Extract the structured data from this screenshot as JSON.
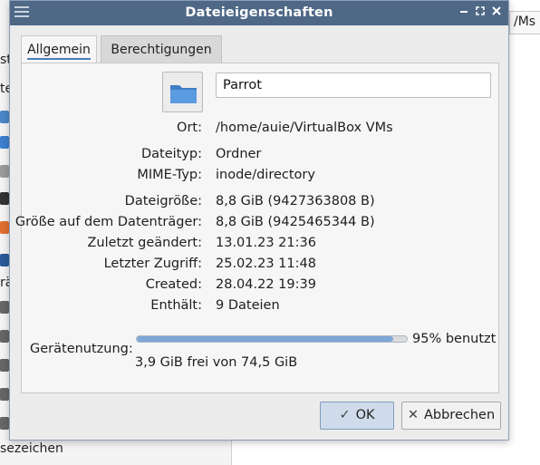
{
  "background": {
    "sidebar_fragments": [
      "st",
      "te",
      "rä"
    ],
    "bottom_fragment": "sezeichen",
    "topright_fragment": "/Ms"
  },
  "dialog": {
    "title": "Dateieigenschaften",
    "tabs": [
      {
        "label": "Allgemein",
        "active": true
      },
      {
        "label": "Berechtigungen",
        "active": false
      }
    ],
    "name_value": "Parrot",
    "properties": {
      "location": {
        "label": "Ort:",
        "value": "/home/auie/VirtualBox VMs"
      },
      "file_type": {
        "label": "Dateityp:",
        "value": "Ordner"
      },
      "mime_type": {
        "label": "MIME-Typ:",
        "value": "inode/directory"
      },
      "file_size": {
        "label": "Dateigröße:",
        "value": "8,8 GiB (9427363808 B)"
      },
      "disk_size": {
        "label": "Größe auf dem Datenträger:",
        "value": "8,8 GiB (9425465344 B)"
      },
      "modified": {
        "label": "Zuletzt geändert:",
        "value": "13.01.23 21:36"
      },
      "accessed": {
        "label": "Letzter Zugriff:",
        "value": "25.02.23 11:48"
      },
      "created": {
        "label": "Created:",
        "value": "28.04.22 19:39"
      },
      "contains": {
        "label": "Enthält:",
        "value": "9 Dateien"
      }
    },
    "device_usage": {
      "label": "Gerätenutzung:",
      "percent_used": 95,
      "percent_text": "95% benutzt",
      "free_text": "3,9 GiB frei von 74,5 GiB"
    },
    "buttons": {
      "ok": "OK",
      "cancel": "Abbrechen"
    }
  },
  "colors": {
    "titlebar": "#4e6886",
    "accent": "#4a7fb8",
    "progress": "#7ea7d6",
    "folder": "#4a86c8"
  }
}
